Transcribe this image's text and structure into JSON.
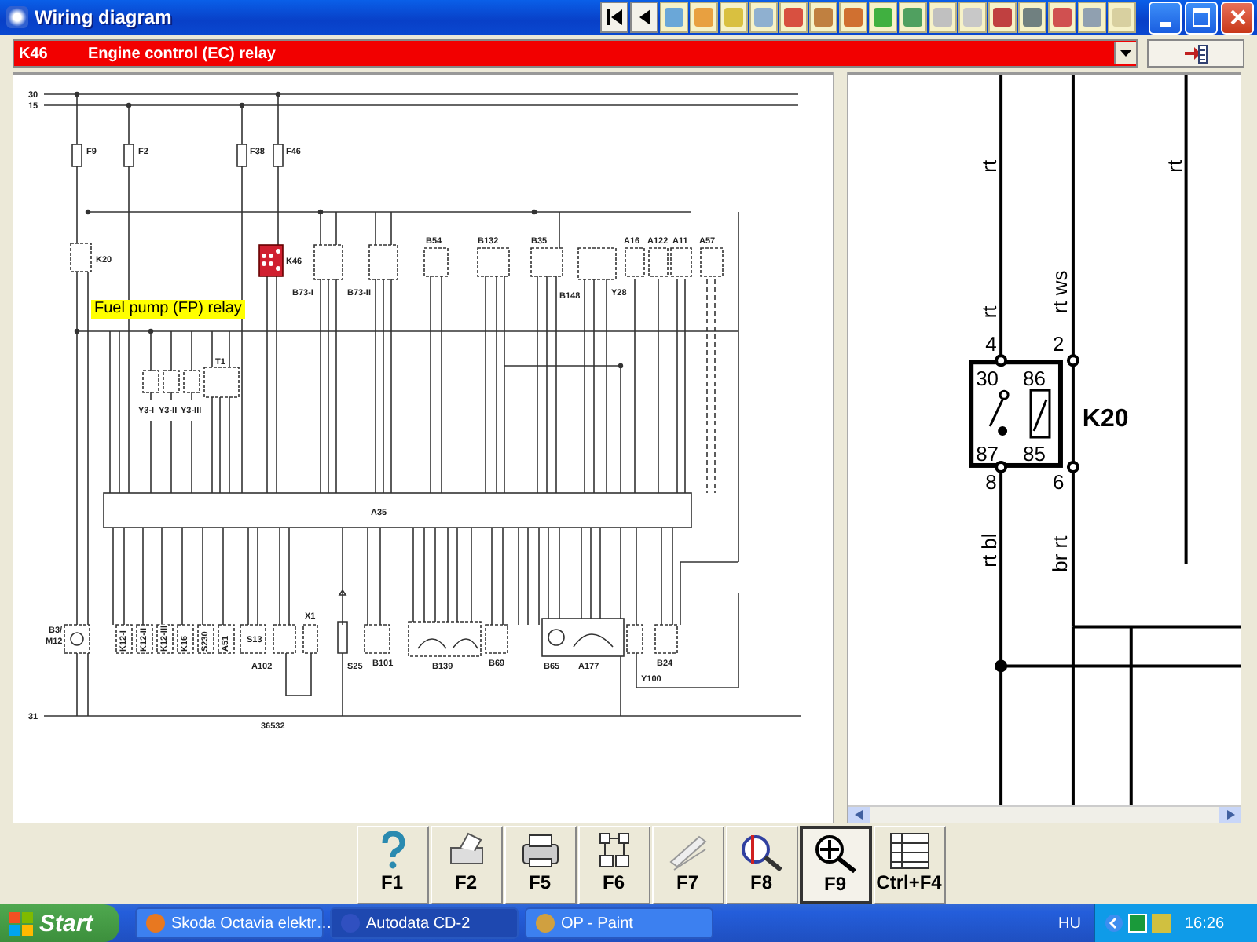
{
  "window": {
    "title": "Wiring diagram"
  },
  "selector": {
    "code": "K46",
    "name": "Engine control (EC) relay"
  },
  "diagram": {
    "labels": [
      {
        "text": "30"
      },
      {
        "text": "15"
      },
      {
        "text": "31"
      },
      {
        "text": "F9"
      },
      {
        "text": "F2"
      },
      {
        "text": "F38"
      },
      {
        "text": "F46"
      },
      {
        "text": "K20"
      },
      {
        "text": "K46"
      },
      {
        "text": "B73-I"
      },
      {
        "text": "B73-II"
      },
      {
        "text": "B54"
      },
      {
        "text": "B132"
      },
      {
        "text": "B35"
      },
      {
        "text": "B148"
      },
      {
        "text": "Y28"
      },
      {
        "text": "A16"
      },
      {
        "text": "A122"
      },
      {
        "text": "A11"
      },
      {
        "text": "A57"
      },
      {
        "text": "Y3-I"
      },
      {
        "text": "Y3-II"
      },
      {
        "text": "Y3-III"
      },
      {
        "text": "T1"
      },
      {
        "text": "A35"
      },
      {
        "text": "B3/"
      },
      {
        "text": "M12"
      },
      {
        "text": "K12-I"
      },
      {
        "text": "K12-II"
      },
      {
        "text": "K12-III"
      },
      {
        "text": "K16"
      },
      {
        "text": "S230"
      },
      {
        "text": "A51"
      },
      {
        "text": "S13"
      },
      {
        "text": "A102"
      },
      {
        "text": "X1"
      },
      {
        "text": "S25"
      },
      {
        "text": "B101"
      },
      {
        "text": "B139"
      },
      {
        "text": "B69"
      },
      {
        "text": "B65"
      },
      {
        "text": "A177"
      },
      {
        "text": "Y100"
      },
      {
        "text": "B24"
      },
      {
        "text": "36532"
      }
    ],
    "callout": "Fuel pump (FP) relay"
  },
  "zoom_view": {
    "labels": [
      {
        "text": "rt"
      },
      {
        "text": "rt"
      },
      {
        "text": "rt"
      },
      {
        "text": "rt ws"
      },
      {
        "text": "4"
      },
      {
        "text": "2"
      },
      {
        "text": "30"
      },
      {
        "text": "86"
      },
      {
        "text": "87"
      },
      {
        "text": "85"
      },
      {
        "text": "8"
      },
      {
        "text": "6"
      },
      {
        "text": "rt bl"
      },
      {
        "text": "br rt"
      }
    ],
    "relay": "K20"
  },
  "function_keys": [
    {
      "label": "F1",
      "kind": "help",
      "selected": false
    },
    {
      "label": "F2",
      "kind": "print-setup",
      "selected": false
    },
    {
      "label": "F5",
      "kind": "print",
      "selected": false
    },
    {
      "label": "F6",
      "kind": "diagram",
      "selected": false
    },
    {
      "label": "F7",
      "kind": "pen",
      "selected": false
    },
    {
      "label": "F8",
      "kind": "inspect",
      "selected": false
    },
    {
      "label": "F9",
      "kind": "zoom",
      "selected": true
    },
    {
      "label": "Ctrl+F4",
      "kind": "list",
      "selected": false
    }
  ],
  "taskbar": {
    "start": "Start",
    "tasks": [
      {
        "label": "Skoda Octavia elektr…",
        "kind": "browser",
        "selected": false
      },
      {
        "label": "Autodata CD-2",
        "kind": "autodata",
        "selected": true
      },
      {
        "label": "OP - Paint",
        "kind": "paint",
        "selected": false
      }
    ],
    "language": "HU",
    "time": "16:26"
  }
}
